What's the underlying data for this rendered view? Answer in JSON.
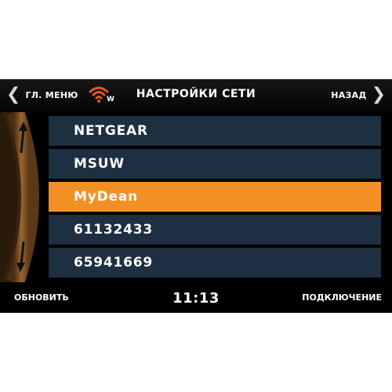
{
  "header": {
    "back_left_label": "ГЛ. МЕНЮ",
    "title": "НАСТРОЙКИ СЕТИ",
    "back_right_label": "НАЗАД",
    "wifi_badge": "W",
    "wifi_icon": "wifi-icon"
  },
  "networks": [
    {
      "label": "NETGEAR",
      "selected": false
    },
    {
      "label": "MSUW",
      "selected": false
    },
    {
      "label": "MyDean",
      "selected": true
    },
    {
      "label": "61132433",
      "selected": false
    },
    {
      "label": "65941669",
      "selected": false
    }
  ],
  "footer": {
    "refresh_label": "ОБНОВИТЬ",
    "clock": "11:13",
    "connect_label": "ПОДКЛЮЧЕНИЕ"
  },
  "colors": {
    "accent": "#f39025",
    "row_bg": "#1d2f40",
    "scroller": "#8a5a2a",
    "wifi": "#e0532a"
  }
}
